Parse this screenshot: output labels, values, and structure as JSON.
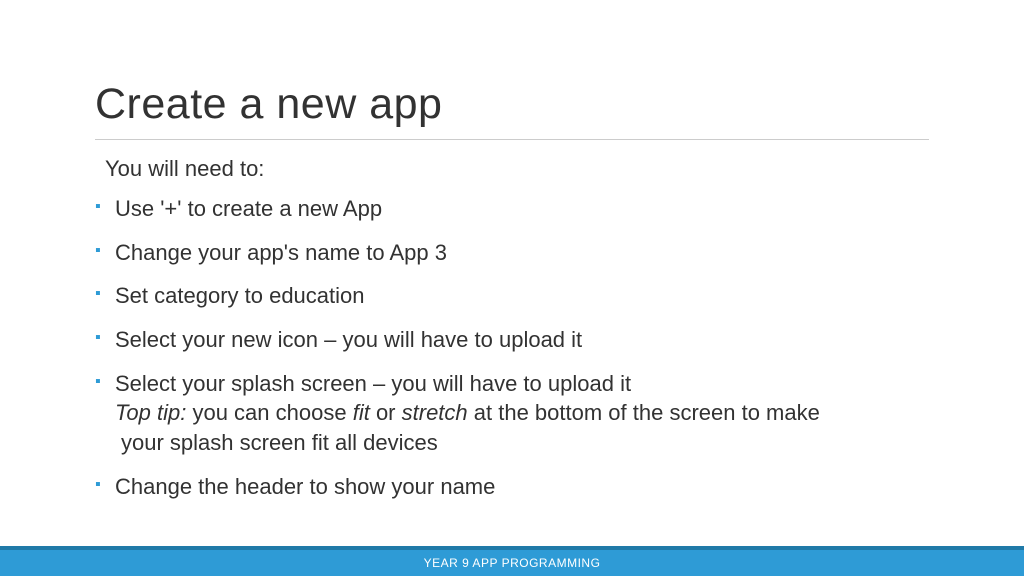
{
  "title": "Create a new app",
  "intro": "You will need to:",
  "bullets": {
    "b1": "Use '+' to create a new App",
    "b2": "Change your app's name to App 3",
    "b3": "Set category to education",
    "b4": "Select your new icon – you will have to upload it",
    "b5_main": "Select your splash screen – you will have to upload it",
    "b5_tip_label": "Top tip:",
    "b5_tip_part1": " you can choose ",
    "b5_tip_fit": "fit",
    "b5_tip_part2": " or ",
    "b5_tip_stretch": "stretch",
    "b5_tip_part3": " at the bottom of the screen to make",
    "b5_tip_line2": " your splash screen fit all devices",
    "b6": "Change the header to show your name"
  },
  "footer": "YEAR 9 APP PROGRAMMING"
}
